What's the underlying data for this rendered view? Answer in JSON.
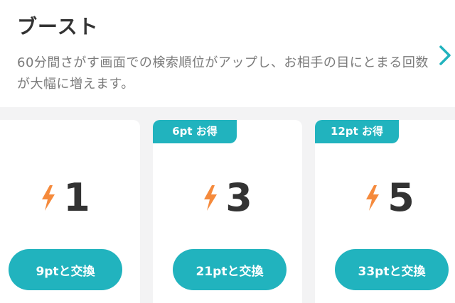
{
  "boost": {
    "title": "ブースト",
    "description": "60分間さがす画面での検索順位がアップし、お相手の目にとまる回数が大幅に増えます。"
  },
  "colors": {
    "accent": "#21b3be",
    "bolt": "#f58a3c",
    "text": "#333333",
    "muted": "#7b7b7b"
  },
  "cards": [
    {
      "count": "1",
      "button_label": "9ptと交換"
    },
    {
      "ribbon": "6pt お得",
      "count": "3",
      "button_label": "21ptと交換"
    },
    {
      "ribbon": "12pt お得",
      "count": "5",
      "button_label": "33ptと交換"
    }
  ]
}
